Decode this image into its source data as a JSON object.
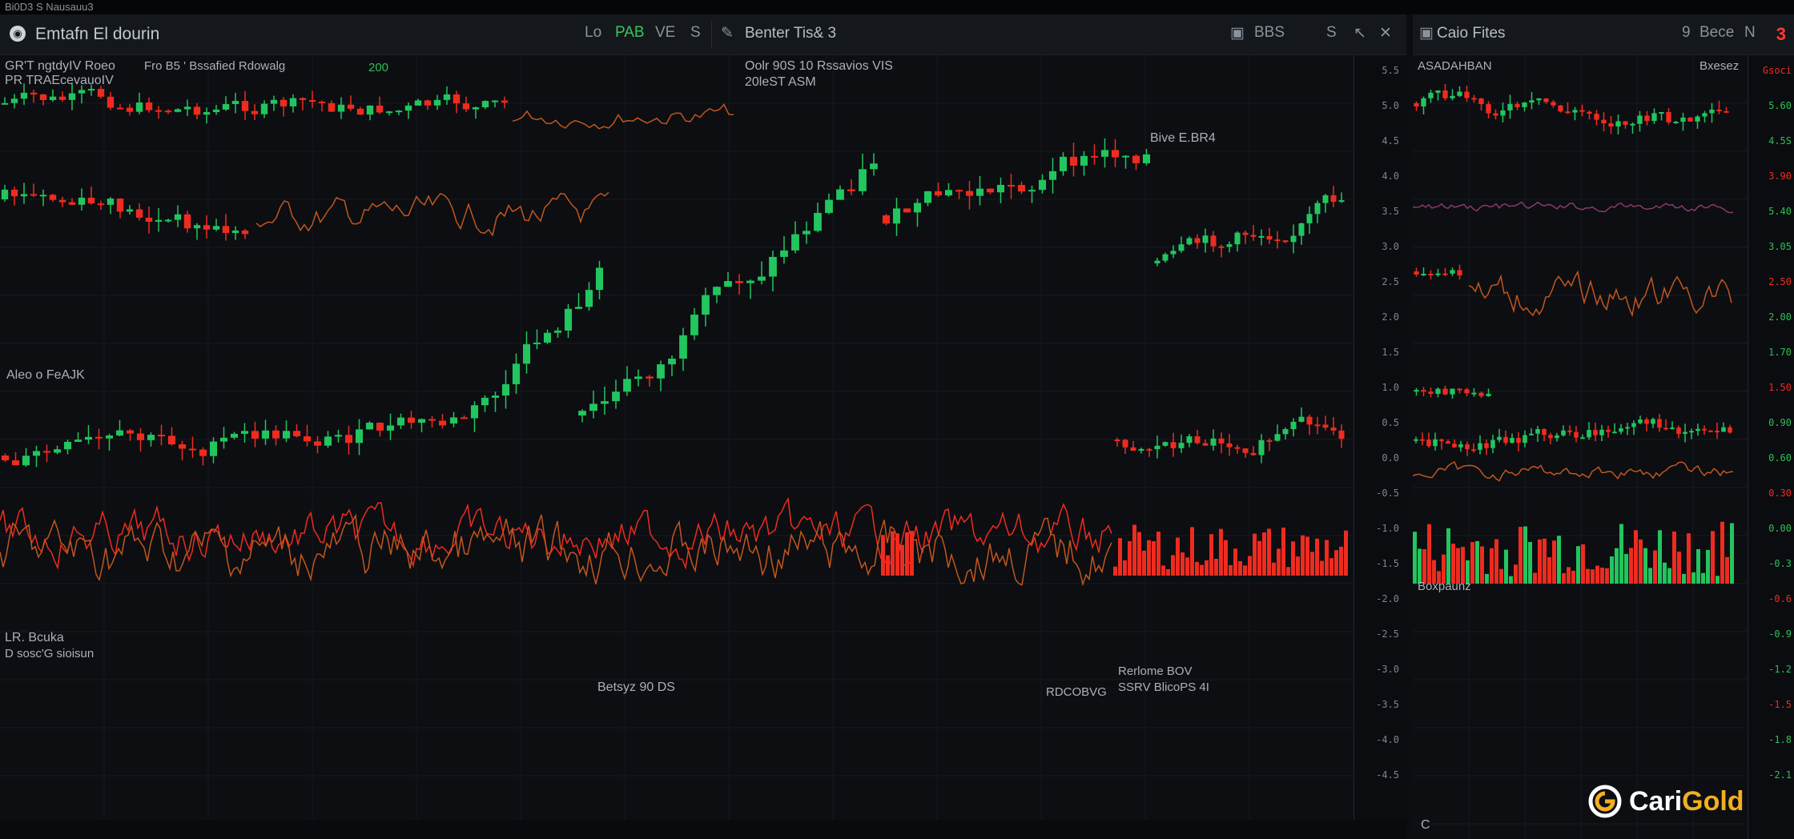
{
  "os_bar": {
    "title": "Bi0D3 S Nausauu3"
  },
  "main": {
    "toolbar": {
      "title": "Emtafn El dourin",
      "btn_lo": "Lo",
      "btn_pab": "PAB",
      "btn_ve": "VE",
      "btn_s": "S",
      "tab_title": "Benter Tis& 3",
      "btn_b": "BBS",
      "btn_min": "S",
      "btn_close": "✕"
    },
    "labels": {
      "top_left_1": "GR'T ngtdyIV Roeo",
      "top_left_2": "PR TRAEcevauoIV",
      "top_info": "Fro B5 ' Bssafied Rdowalg",
      "top_value": "200",
      "center_1": "Oolr 90S 10 Rssavios VIS",
      "center_2": "20leST ASM",
      "right_top": "Bive E.BR4",
      "mid_left": "Aleo o FeAJK",
      "lower_left_1": "LR. Bcuka",
      "lower_left_2": "D sosc'G sioisun",
      "bottom_center": "Betsyz 90 DS",
      "bottom_right_1": "RDCOBVG",
      "bottom_right_2": "Rerlome BOV",
      "bottom_right_3": "SSRV BlicoPS 4I"
    },
    "axis_ticks": [
      "5.5",
      "5.0",
      "4.5",
      "4.0",
      "3.5",
      "3.0",
      "2.5",
      "2.0",
      "1.5",
      "1.0",
      "0.5",
      "0.0",
      "-0.5",
      "-1.0",
      "-1.5",
      "-2.0",
      "-2.5",
      "-3.0",
      "-3.5",
      "-4.0",
      "-4.5"
    ]
  },
  "side": {
    "toolbar": {
      "title": "Caio Fites",
      "btn_9": "9",
      "btn_bece": "Bece",
      "btn_n": "N",
      "badge": "3"
    },
    "labels": {
      "top_left": "ASADAHBAN",
      "top_right": "Bxesez",
      "mid": "Boxpaunz",
      "bottom_left": "C"
    },
    "axis_ticks": [
      "Gsoci",
      "5.60",
      "4.5S",
      "3.90",
      "5.40",
      "3.05",
      "2.50",
      "2.00",
      "1.70",
      "1.50",
      "0.90",
      "0.60",
      "0.30",
      "0.00",
      "-0.3",
      "-0.6",
      "-0.9",
      "-1.2",
      "-1.5",
      "-1.8",
      "-2.1"
    ]
  },
  "brand": {
    "part1": "Cari",
    "part2": "Gold"
  },
  "colors": {
    "up": "#22c55e",
    "down": "#ef2b1f",
    "orange": "#c2561e",
    "bg": "#0b0d11",
    "gold": "#f2b01e"
  }
}
